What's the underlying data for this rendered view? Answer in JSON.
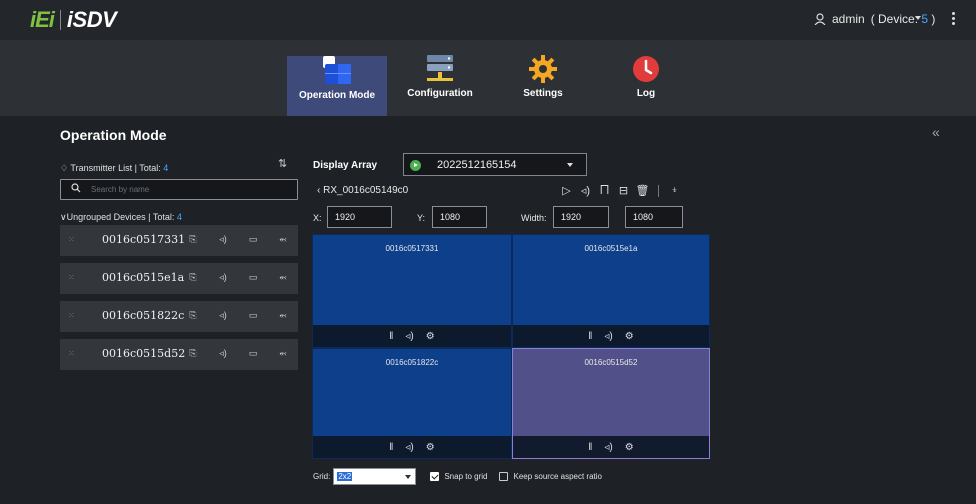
{
  "brand": {
    "ie": "iEi",
    "isdv": "iSDV"
  },
  "user": {
    "name": "admin",
    "device_prefix": "( Device: ",
    "device_count": "5",
    "device_suffix": " )"
  },
  "nav": [
    {
      "label": "Operation Mode",
      "icon": "operation-mode-icon",
      "active": true
    },
    {
      "label": "Configuration",
      "icon": "configuration-icon",
      "active": false
    },
    {
      "label": "Settings",
      "icon": "settings-gear-icon",
      "active": false
    },
    {
      "label": "Log",
      "icon": "log-clock-icon",
      "active": false
    }
  ],
  "page_title": "Operation Mode",
  "transmitter": {
    "label": "Transmitter List | Total: ",
    "total": "4",
    "search_placeholder": "Search by name",
    "ungrouped_label": "Ungrouped Devices | Total: ",
    "ungrouped_total": "4",
    "devices": [
      {
        "name": "0016c0517331"
      },
      {
        "name": "0016c0515e1a"
      },
      {
        "name": "0016c051822c"
      },
      {
        "name": "0016c0515d52"
      }
    ]
  },
  "display_array": {
    "label": "Display Array",
    "selected": "2022512165154",
    "rx_name": "RX_0016c05149c0",
    "x_label": "X:",
    "x": "1920",
    "y_label": "Y:",
    "y": "1080",
    "width_label": "Width:",
    "width": "1920",
    "height": "1080"
  },
  "cells": [
    {
      "name": "0016c0517331",
      "selected": false
    },
    {
      "name": "0016c0515e1a",
      "selected": false
    },
    {
      "name": "0016c051822c",
      "selected": false
    },
    {
      "name": "0016c0515d52",
      "selected": true
    }
  ],
  "bottom": {
    "grid_label": "Grid:",
    "grid_value": "2x2",
    "snap_label": "Snap to grid",
    "snap_checked": true,
    "aspect_label": "Keep source aspect ratio",
    "aspect_checked": false
  },
  "colors": {
    "accent": "#4aa8ff",
    "active_nav": "#3d4a7a",
    "cell": "#0d3f8a",
    "cell_selected": "#525089"
  }
}
